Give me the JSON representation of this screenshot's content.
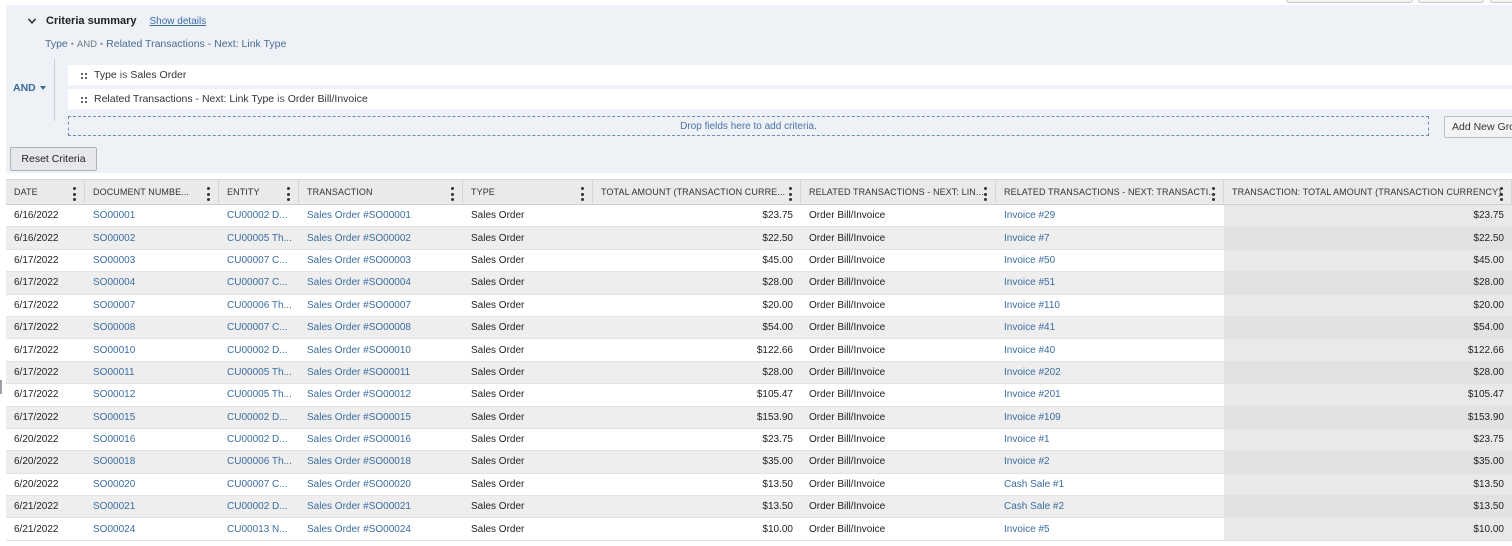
{
  "criteria": {
    "summary_title": "Criteria summary",
    "show_details": "Show details",
    "summary_type": "Type",
    "summary_op": "AND",
    "summary_field": "Related Transactions - Next: Link Type",
    "logic_operator": "AND",
    "rows": [
      {
        "field": "Type",
        "condition": "is",
        "value": "Sales Order"
      },
      {
        "field": "Related Transactions - Next: Link Type",
        "condition": "is",
        "value": "Order Bill/Invoice"
      }
    ],
    "dropzone": "Drop fields here to add criteria.",
    "add_group": "Add New Group",
    "reset": "Reset Criteria"
  },
  "table": {
    "columns": [
      "DATE",
      "DOCUMENT NUMBE...",
      "ENTITY",
      "TRANSACTION",
      "TYPE",
      "TOTAL AMOUNT (TRANSACTION CURRE...",
      "RELATED TRANSACTIONS - NEXT: LIN...",
      "RELATED TRANSACTIONS - NEXT: TRANSACTI...",
      "TRANSACTION: TOTAL AMOUNT (TRANSACTION CURRENCY)"
    ],
    "rows": [
      [
        "6/16/2022",
        "SO00001",
        "CU00002 D...",
        "Sales Order #SO00001",
        "Sales Order",
        "$23.75",
        "Order Bill/Invoice",
        "Invoice #29",
        "$23.75"
      ],
      [
        "6/16/2022",
        "SO00002",
        "CU00005 Th...",
        "Sales Order #SO00002",
        "Sales Order",
        "$22.50",
        "Order Bill/Invoice",
        "Invoice #7",
        "$22.50"
      ],
      [
        "6/17/2022",
        "SO00003",
        "CU00007 C...",
        "Sales Order #SO00003",
        "Sales Order",
        "$45.00",
        "Order Bill/Invoice",
        "Invoice #50",
        "$45.00"
      ],
      [
        "6/17/2022",
        "SO00004",
        "CU00007 C...",
        "Sales Order #SO00004",
        "Sales Order",
        "$28.00",
        "Order Bill/Invoice",
        "Invoice #51",
        "$28.00"
      ],
      [
        "6/17/2022",
        "SO00007",
        "CU00006 Th...",
        "Sales Order #SO00007",
        "Sales Order",
        "$20.00",
        "Order Bill/Invoice",
        "Invoice #110",
        "$20.00"
      ],
      [
        "6/17/2022",
        "SO00008",
        "CU00007 C...",
        "Sales Order #SO00008",
        "Sales Order",
        "$54.00",
        "Order Bill/Invoice",
        "Invoice #41",
        "$54.00"
      ],
      [
        "6/17/2022",
        "SO00010",
        "CU00002 D...",
        "Sales Order #SO00010",
        "Sales Order",
        "$122.66",
        "Order Bill/Invoice",
        "Invoice #40",
        "$122.66"
      ],
      [
        "6/17/2022",
        "SO00011",
        "CU00005 Th...",
        "Sales Order #SO00011",
        "Sales Order",
        "$28.00",
        "Order Bill/Invoice",
        "Invoice #202",
        "$28.00"
      ],
      [
        "6/17/2022",
        "SO00012",
        "CU00005 Th...",
        "Sales Order #SO00012",
        "Sales Order",
        "$105.47",
        "Order Bill/Invoice",
        "Invoice #201",
        "$105.47"
      ],
      [
        "6/17/2022",
        "SO00015",
        "CU00002 D...",
        "Sales Order #SO00015",
        "Sales Order",
        "$153.90",
        "Order Bill/Invoice",
        "Invoice #109",
        "$153.90"
      ],
      [
        "6/20/2022",
        "SO00016",
        "CU00002 D...",
        "Sales Order #SO00016",
        "Sales Order",
        "$23.75",
        "Order Bill/Invoice",
        "Invoice #1",
        "$23.75"
      ],
      [
        "6/20/2022",
        "SO00018",
        "CU00006 Th...",
        "Sales Order #SO00018",
        "Sales Order",
        "$35.00",
        "Order Bill/Invoice",
        "Invoice #2",
        "$35.00"
      ],
      [
        "6/20/2022",
        "SO00020",
        "CU00007 C...",
        "Sales Order #SO00020",
        "Sales Order",
        "$13.50",
        "Order Bill/Invoice",
        "Cash Sale #1",
        "$13.50"
      ],
      [
        "6/21/2022",
        "SO00021",
        "CU00002 D...",
        "Sales Order #SO00021",
        "Sales Order",
        "$13.50",
        "Order Bill/Invoice",
        "Cash Sale #2",
        "$13.50"
      ],
      [
        "6/21/2022",
        "SO00024",
        "CU00013 N...",
        "Sales Order #SO00024",
        "Sales Order",
        "$10.00",
        "Order Bill/Invoice",
        "Invoice #5",
        "$10.00"
      ]
    ],
    "link_columns": [
      1,
      2,
      3,
      7
    ],
    "numeric_columns": [
      5,
      8
    ]
  },
  "colors": {
    "criteria_bg": "#eef1f6",
    "link": "#3a6da0",
    "header_bg": "#eaeaea",
    "stripe": "#eeeeee"
  }
}
